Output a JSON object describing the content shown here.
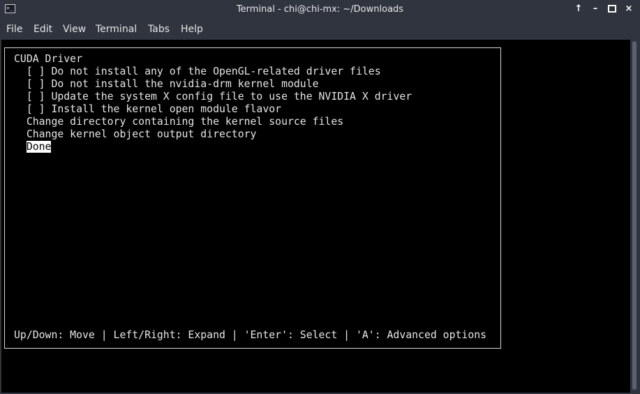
{
  "window": {
    "title": "Terminal - chi@chi-mx: ~/Downloads",
    "app_icon_glyph": ">_",
    "buttons": {
      "keep_above": "↑",
      "minimize": "–",
      "close": "×"
    }
  },
  "menubar": {
    "items": [
      "File",
      "Edit",
      "View",
      "Terminal",
      "Tabs",
      "Help"
    ]
  },
  "dialog": {
    "heading": "CUDA Driver",
    "options": [
      "  [ ] Do not install any of the OpenGL-related driver files",
      "  [ ] Do not install the nvidia-drm kernel module",
      "  [ ] Update the system X config file to use the NVIDIA X driver",
      "  [ ] Install the kernel open module flavor",
      "  Change directory containing the kernel source files",
      "  Change kernel object output directory"
    ],
    "indent": "  ",
    "selected_item": "Done",
    "footer": "Up/Down: Move | Left/Right: Expand | 'Enter': Select | 'A': Advanced options"
  }
}
